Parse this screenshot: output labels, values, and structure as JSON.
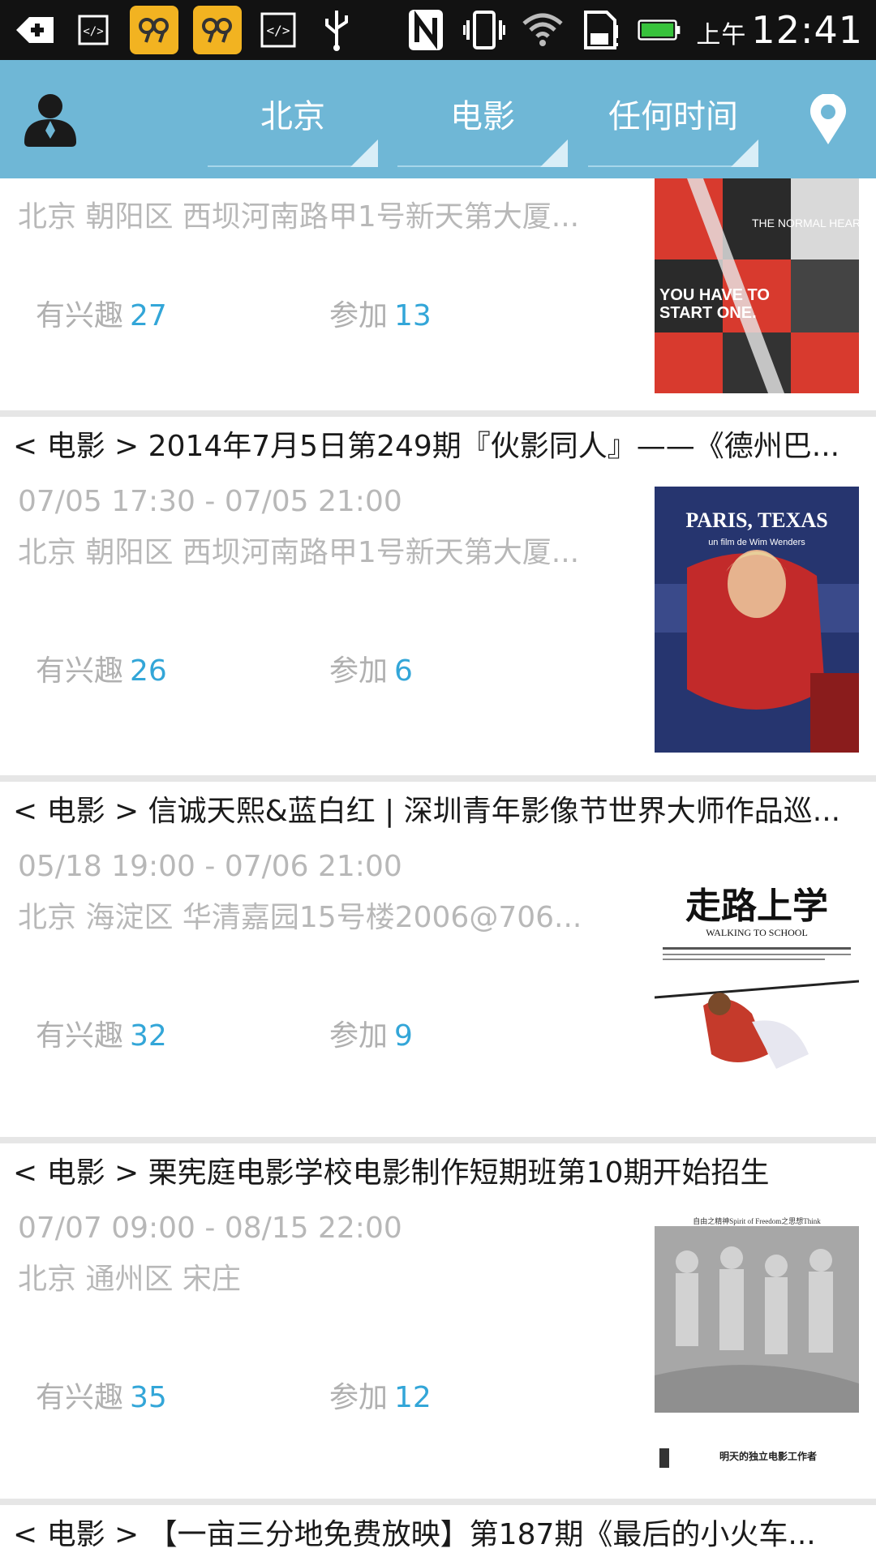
{
  "status_bar": {
    "ampm": "上午",
    "time": "12:41",
    "icons": [
      "add-icon",
      "code-icon",
      "app-tile-icon",
      "app-tile-icon",
      "code-icon",
      "usb-icon",
      "nfc-icon",
      "vibrate-icon",
      "wifi-icon",
      "storage-icon",
      "battery-icon"
    ]
  },
  "app_bar": {
    "city": "北京",
    "category": "电影",
    "time_filter": "任何时间",
    "icons": {
      "profile": "profile-icon",
      "location": "location-pin-icon"
    }
  },
  "labels": {
    "interested": "有兴趣",
    "attend": "参加"
  },
  "events": [
    {
      "title": "",
      "time": "",
      "address": "北京 朝阳区 西坝河南路甲1号新天第大厦...",
      "interested": "27",
      "attend": "13",
      "poster": {
        "text": "YOU HAVE TO START ONE. THE NORMAL HEART",
        "colors": [
          "#d83a2e",
          "#222222",
          "#f1f1f1"
        ]
      }
    },
    {
      "title": "< 电影 > 2014年7月5日第249期『伙影同人』——《德州巴...",
      "time": "07/05 17:30 - 07/05 21:00",
      "address": "北京 朝阳区 西坝河南路甲1号新天第大厦...",
      "interested": "26",
      "attend": "6",
      "poster": {
        "text": "PARIS, TEXAS",
        "subtext": "un film de Wim Wenders",
        "colors": [
          "#2c3a78",
          "#c22a2a",
          "#e4b38b"
        ]
      }
    },
    {
      "title": "< 电影 > 信诚天熙&蓝白红 | 深圳青年影像节世界大师作品巡...",
      "time": "05/18 19:00 - 07/06 21:00",
      "address": "北京 海淀区 华清嘉园15号楼2006@706...",
      "interested": "32",
      "attend": "9",
      "poster": {
        "text": "走路上学",
        "subtext": "WALKING TO SCHOOL",
        "colors": [
          "#ffffff",
          "#111111",
          "#c53a2b"
        ]
      }
    },
    {
      "title": "< 电影 > 栗宪庭电影学校电影制作短期班第10期开始招生",
      "time": "07/07 09:00 - 08/15 22:00",
      "address": "北京 通州区 宋庄",
      "interested": "35",
      "attend": "12",
      "poster": {
        "text": "自由之精神Spirit of Freedom之思想Think",
        "subtext": "明天的独立电影工作者",
        "colors": [
          "#9b9b9b",
          "#cfcfcf",
          "#ffffff"
        ]
      }
    },
    {
      "title": "< 电影 > 【一亩三分地免费放映】第187期《最后的小火车..."
    }
  ]
}
